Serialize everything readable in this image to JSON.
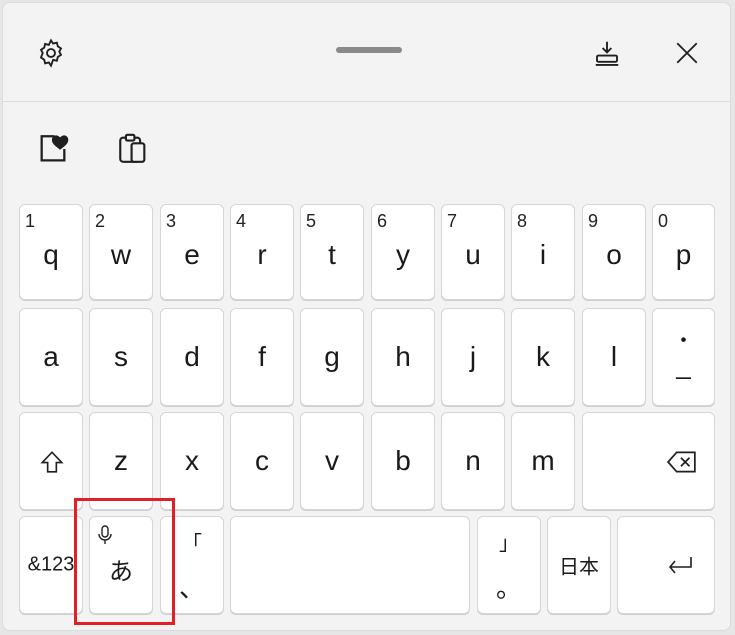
{
  "title_bar": {
    "settings_icon": "gear-icon",
    "dock_icon": "dock-to-bottom-icon",
    "close_icon": "close-icon"
  },
  "toolbar": {
    "emoji_icon": "emoji-heart-icon",
    "clipboard_icon": "clipboard-icon"
  },
  "keyboard": {
    "row1": [
      {
        "num": "1",
        "char": "q"
      },
      {
        "num": "2",
        "char": "w"
      },
      {
        "num": "3",
        "char": "e"
      },
      {
        "num": "4",
        "char": "r"
      },
      {
        "num": "5",
        "char": "t"
      },
      {
        "num": "6",
        "char": "y"
      },
      {
        "num": "7",
        "char": "u"
      },
      {
        "num": "8",
        "char": "i"
      },
      {
        "num": "9",
        "char": "o"
      },
      {
        "num": "0",
        "char": "p"
      }
    ],
    "row2": [
      "a",
      "s",
      "d",
      "f",
      "g",
      "h",
      "j",
      "k",
      "l"
    ],
    "row2_last": {
      "top": "・",
      "bottom": "_"
    },
    "row3": [
      "z",
      "x",
      "c",
      "v",
      "b",
      "n",
      "m"
    ],
    "symbols_label": "&123",
    "ime_label": "あ",
    "mic_icon": "microphone-icon",
    "bracket_open": "「",
    "comma": "、",
    "bracket_close": "」",
    "period": "。",
    "lang_label": "日本",
    "shift_icon": "shift-icon",
    "backspace_icon": "backspace-icon",
    "enter_icon": "enter-icon"
  },
  "accent_colors": {
    "highlight": "#e01f26"
  }
}
